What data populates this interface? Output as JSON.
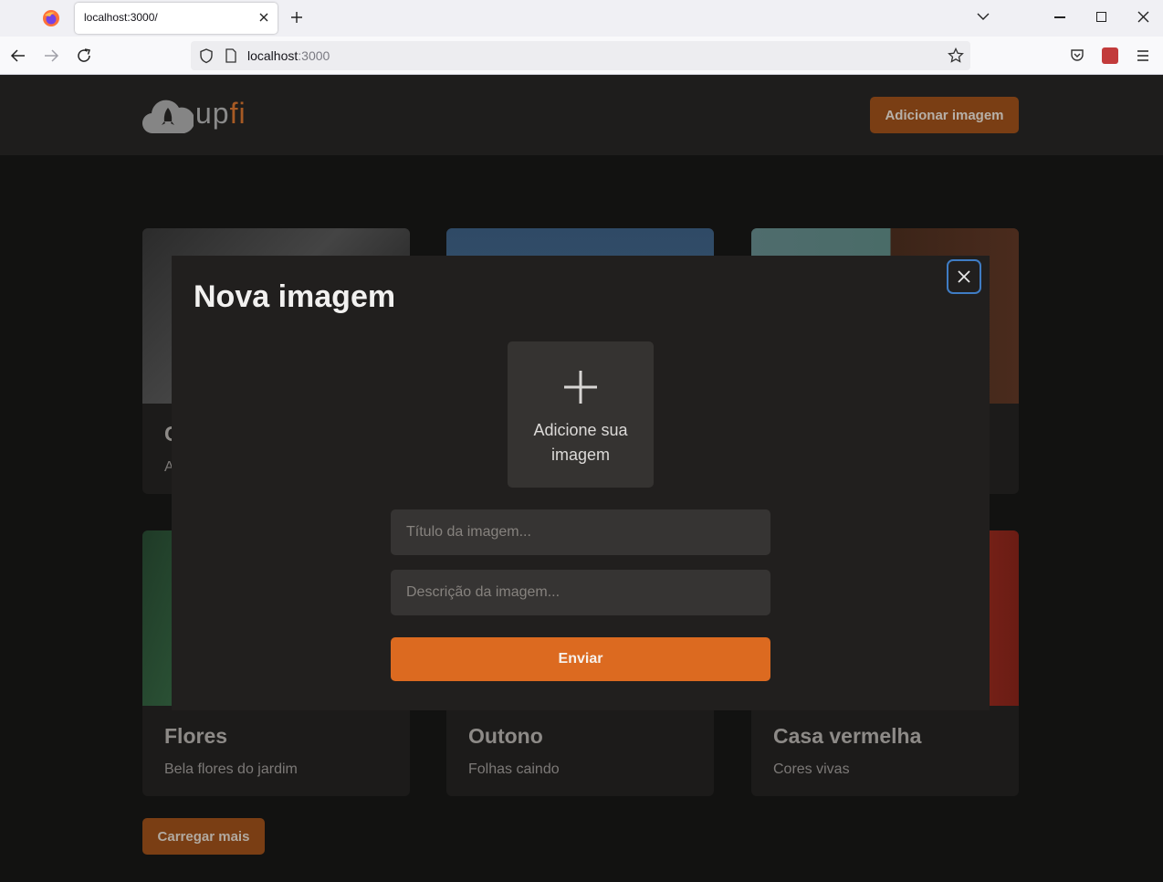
{
  "browser": {
    "tab_title": "localhost:3000/",
    "url_host": "localhost",
    "url_port": ":3000"
  },
  "header": {
    "logo_main": "up",
    "logo_accent": "fi",
    "add_button": "Adicionar imagem"
  },
  "cards": [
    {
      "title": "C",
      "description": "A"
    },
    {
      "title": "",
      "description": ""
    },
    {
      "title": "",
      "description": ""
    },
    {
      "title": "Flores",
      "description": "Bela flores do jardim"
    },
    {
      "title": "Outono",
      "description": "Folhas caindo"
    },
    {
      "title": "Casa vermelha",
      "description": "Cores vivas"
    }
  ],
  "load_more": "Carregar mais",
  "modal": {
    "title": "Nova imagem",
    "upload_label": "Adicione sua imagem",
    "title_placeholder": "Título da imagem...",
    "description_placeholder": "Descrição da imagem...",
    "submit": "Enviar"
  },
  "colors": {
    "accent": "#dd6b20",
    "background": "#121211",
    "surface": "#211f1e"
  }
}
